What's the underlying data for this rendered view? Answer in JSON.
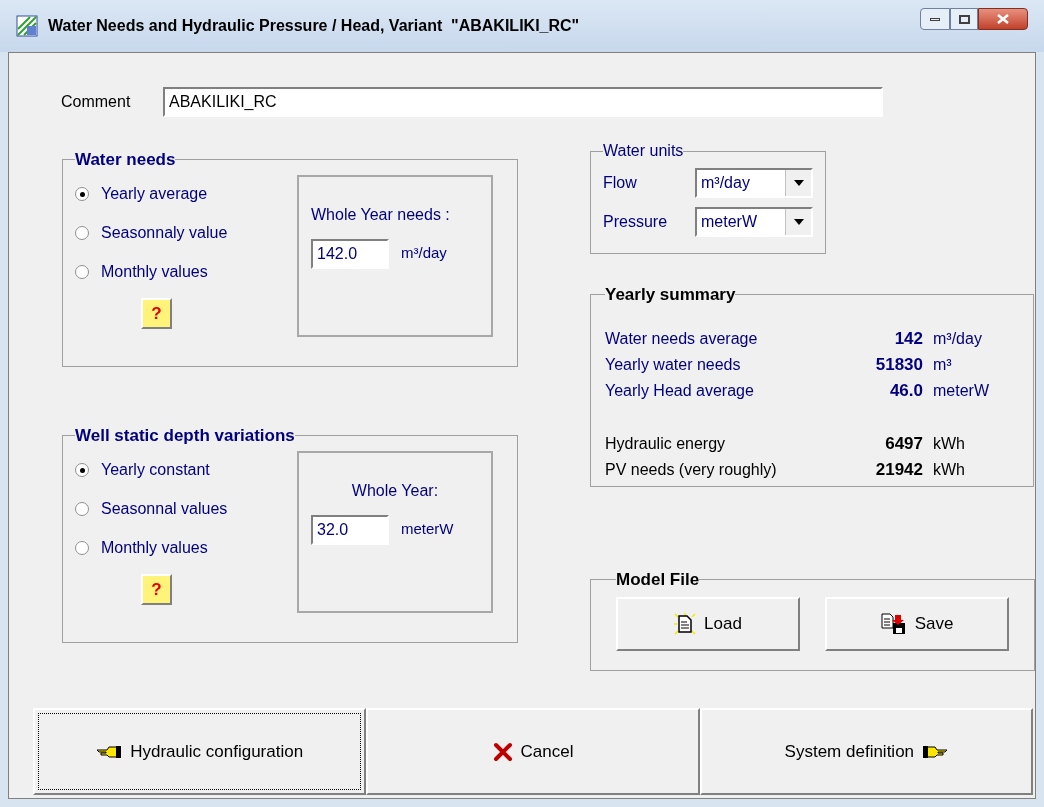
{
  "window": {
    "title": "Water Needs and Hydraulic Pressure / Head, Variant  \"ABAKILIKI_RC\""
  },
  "comment": {
    "label": "Comment",
    "value": "ABAKILIKI_RC"
  },
  "water_needs": {
    "title": "Water needs",
    "options": [
      {
        "label": "Yearly average",
        "selected": true
      },
      {
        "label": "Seasonnaly value",
        "selected": false
      },
      {
        "label": "Monthly values",
        "selected": false
      }
    ],
    "help": "?",
    "box_label": "Whole Year needs :",
    "value": "142.0",
    "unit": "m³/day"
  },
  "well_depth": {
    "title": "Well static depth variations",
    "options": [
      {
        "label": "Yearly constant",
        "selected": true
      },
      {
        "label": "Seasonnal values",
        "selected": false
      },
      {
        "label": "Monthly values",
        "selected": false
      }
    ],
    "help": "?",
    "box_label": "Whole Year:",
    "value": "32.0",
    "unit": "meterW"
  },
  "water_units": {
    "title": "Water units",
    "fields": [
      {
        "label": "Flow",
        "value": "m³/day"
      },
      {
        "label": "Pressure",
        "value": "meterW"
      }
    ]
  },
  "summary": {
    "title": "Yearly summary",
    "rows": [
      {
        "label": "Water needs average",
        "value": "142",
        "unit": "m³/day",
        "kind": "water"
      },
      {
        "label": "Yearly water needs",
        "value": "51830",
        "unit": "m³",
        "kind": "water"
      },
      {
        "label": "Yearly Head average",
        "value": "46.0",
        "unit": "meterW",
        "kind": "water"
      },
      {
        "label": "Hydraulic energy",
        "value": "6497",
        "unit": "kWh",
        "kind": "energy"
      },
      {
        "label": "PV needs (very roughly)",
        "value": "21942",
        "unit": "kWh",
        "kind": "energy"
      }
    ]
  },
  "model_file": {
    "title": "Model File",
    "buttons": [
      {
        "label": "Load",
        "kind": "load"
      },
      {
        "label": "Save",
        "kind": "save"
      }
    ]
  },
  "footer_buttons": [
    {
      "label": "Hydraulic configuration",
      "kind": "back"
    },
    {
      "label": "Cancel",
      "kind": "cancel"
    },
    {
      "label": "System definition",
      "kind": "next"
    }
  ]
}
